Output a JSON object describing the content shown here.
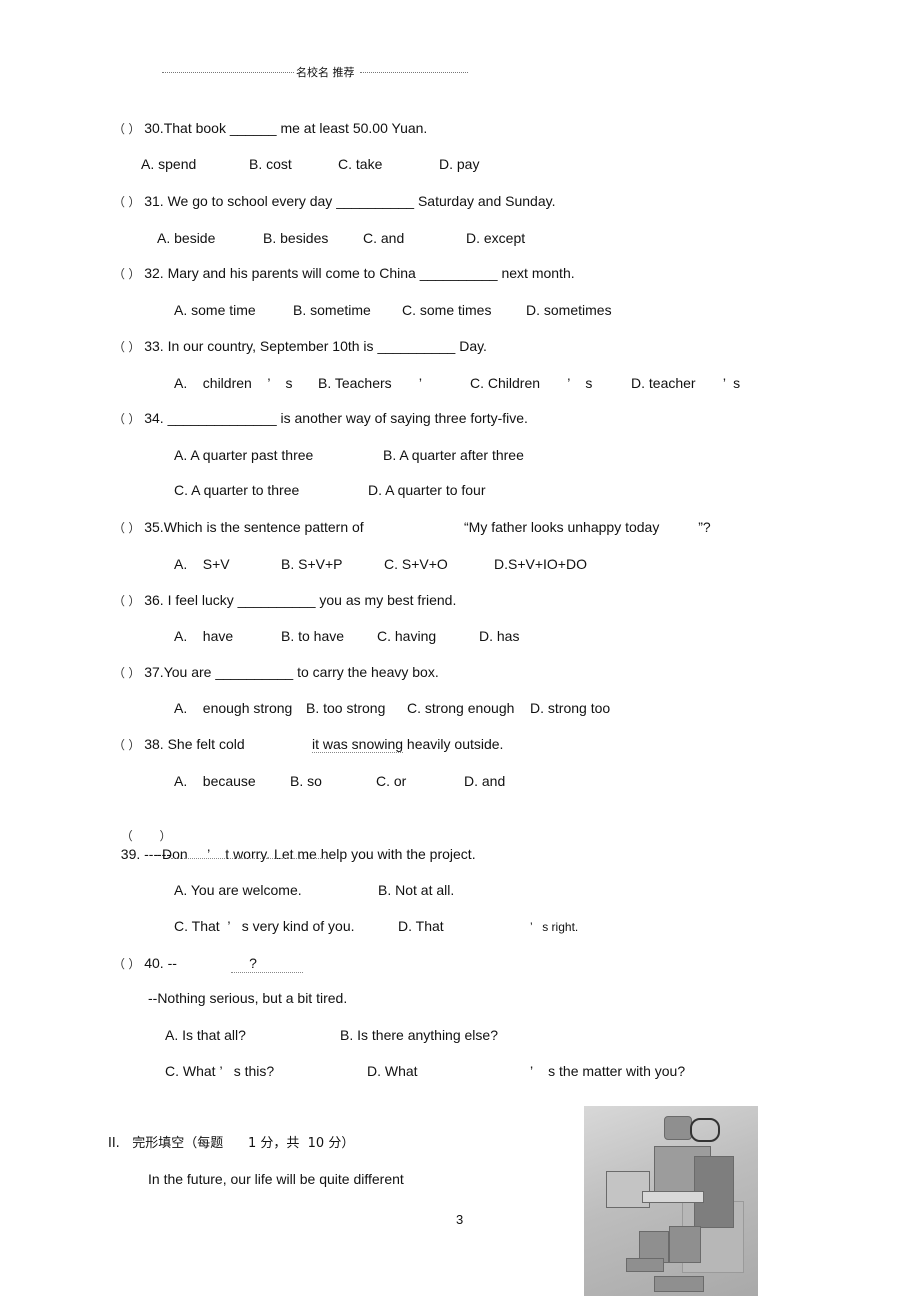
{
  "header": {
    "text": "名校名  推荐"
  },
  "questions": [
    {
      "paren": "（        ）",
      "stem_pre": "30.That book ",
      "blank": "______",
      "stem_post": " me at least 50.00 Yuan.",
      "options": [
        "A. spend",
        "B. cost",
        "C. take",
        "D. pay"
      ]
    },
    {
      "paren": "（        ）",
      "stem_pre": "31. We go to school every day ",
      "blank": "__________",
      "stem_post": " Saturday and Sunday.",
      "options": [
        "A. beside",
        "B. besides",
        "C. and",
        "D. except"
      ]
    },
    {
      "paren": "（        ）",
      "stem_pre": "32. Mary and his parents will come to China ",
      "blank": "__________",
      "stem_post": " next month.",
      "options": [
        "A. some time",
        "B. sometime",
        "C. some times",
        "D. sometimes"
      ]
    },
    {
      "paren": "（        ）",
      "stem_pre": "33. In our country, September 10th is ",
      "blank": "__________",
      "stem_post": " Day.",
      "options": [
        "A.    children    ’    s",
        "B. Teachers       ’",
        "C. Children       ’    s",
        "D. teacher       ’  s"
      ]
    },
    {
      "paren": "（        ）",
      "stem_pre": "34. ",
      "blank": "______________",
      "stem_post": " is another way of saying three forty-five.",
      "options": [
        "A. A quarter past three",
        "B. A quarter after three",
        "C. A quarter to three",
        "D. A quarter to four"
      ]
    },
    {
      "paren": "（        ）",
      "stem_pre": "35.Which is the sentence pattern of",
      "blank": "",
      "stem_post": "“My father looks unhappy today          ”?",
      "options": [
        "A.    S+V",
        "B. S+V+P",
        "C. S+V+O",
        "D.S+V+IO+DO"
      ]
    },
    {
      "paren": "（        ）",
      "stem_pre": "36. I feel lucky ",
      "blank": "__________",
      "stem_post": " you as my best friend.",
      "options": [
        "A.    have",
        "B. to have",
        "C. having",
        "D. has"
      ]
    },
    {
      "paren": "（        ）",
      "stem_pre": "37.You are ",
      "blank": "__________",
      "stem_post": " to carry the heavy box.",
      "options": [
        "A.    enough strong",
        "B. too strong",
        "C. strong enough",
        "D. strong too"
      ]
    },
    {
      "paren": "（        ）",
      "stem_pre": "38. She felt cold",
      "blank": "it was snowing",
      "stem_post": " heavily outside.",
      "options": [
        "A.    because",
        "B. so",
        "C. or",
        "D. and"
      ]
    },
    {
      "paren": "（        ）",
      "stem_pre": "39. --- Don     ’    t worry. Let me help you with the project.",
      "blank": "",
      "stem_post": "",
      "reply": "---",
      "options": [
        "A. You are welcome.",
        "B. Not at all.",
        "C. That  ’   s very kind of you.",
        "D. That"
      ],
      "option_d_tail": "’   s right."
    },
    {
      "paren": "（        ）",
      "stem_pre": "40. --",
      "blank": "?",
      "stem_post": "",
      "reply": "--Nothing serious, but a bit tired.",
      "options": [
        "A. Is that all?",
        "B. Is there anything else?",
        "C. What ’   s this?",
        "D. What"
      ],
      "option_d_tail": "’    s the matter with you?"
    }
  ],
  "section2": {
    "title": "II.   完形填空（每题      1 分，共  10 分）",
    "intro": "In the future, our life will be quite different"
  },
  "page_number": "3",
  "image": {
    "alt": "robot-photo"
  }
}
